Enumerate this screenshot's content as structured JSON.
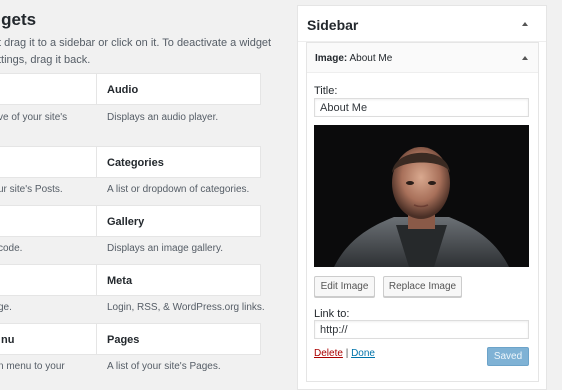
{
  "available_widgets": {
    "title": "idgets",
    "description": "t drag it to a sidebar or click on it. To deactivate a widget ttings, drag it back.",
    "left_column": [
      {
        "label": "",
        "desc": "ve of your site's"
      },
      {
        "label": "",
        "desc": "ur site's Posts."
      },
      {
        "label": "",
        "desc": "code."
      },
      {
        "label": "",
        "desc": "ge."
      },
      {
        "label": "nu",
        "desc": "n menu to your"
      }
    ],
    "right_column": [
      {
        "label": "Audio",
        "desc": "Displays an audio player."
      },
      {
        "label": "Categories",
        "desc": "A list or dropdown of categories."
      },
      {
        "label": "Gallery",
        "desc": "Displays an image gallery."
      },
      {
        "label": "Meta",
        "desc": "Login, RSS, & WordPress.org links."
      },
      {
        "label": "Pages",
        "desc": "A list of your site's Pages."
      }
    ]
  },
  "sidebar": {
    "title": "Sidebar",
    "widget": {
      "type_label": "Image:",
      "name": "About Me",
      "title_label": "Title:",
      "title_value": "About Me",
      "edit_image_label": "Edit Image",
      "replace_image_label": "Replace Image",
      "link_to_label": "Link to:",
      "link_to_value": "http://",
      "delete_label": "Delete",
      "separator": "|",
      "done_label": "Done",
      "saved_label": "Saved"
    }
  },
  "colors": {
    "primary_button": "#7fb2d5",
    "delete_link": "#aa0000",
    "done_link": "#0073aa"
  },
  "icons": {
    "sidebar_toggle": "caret-up-icon",
    "widget_toggle": "caret-up-icon"
  }
}
